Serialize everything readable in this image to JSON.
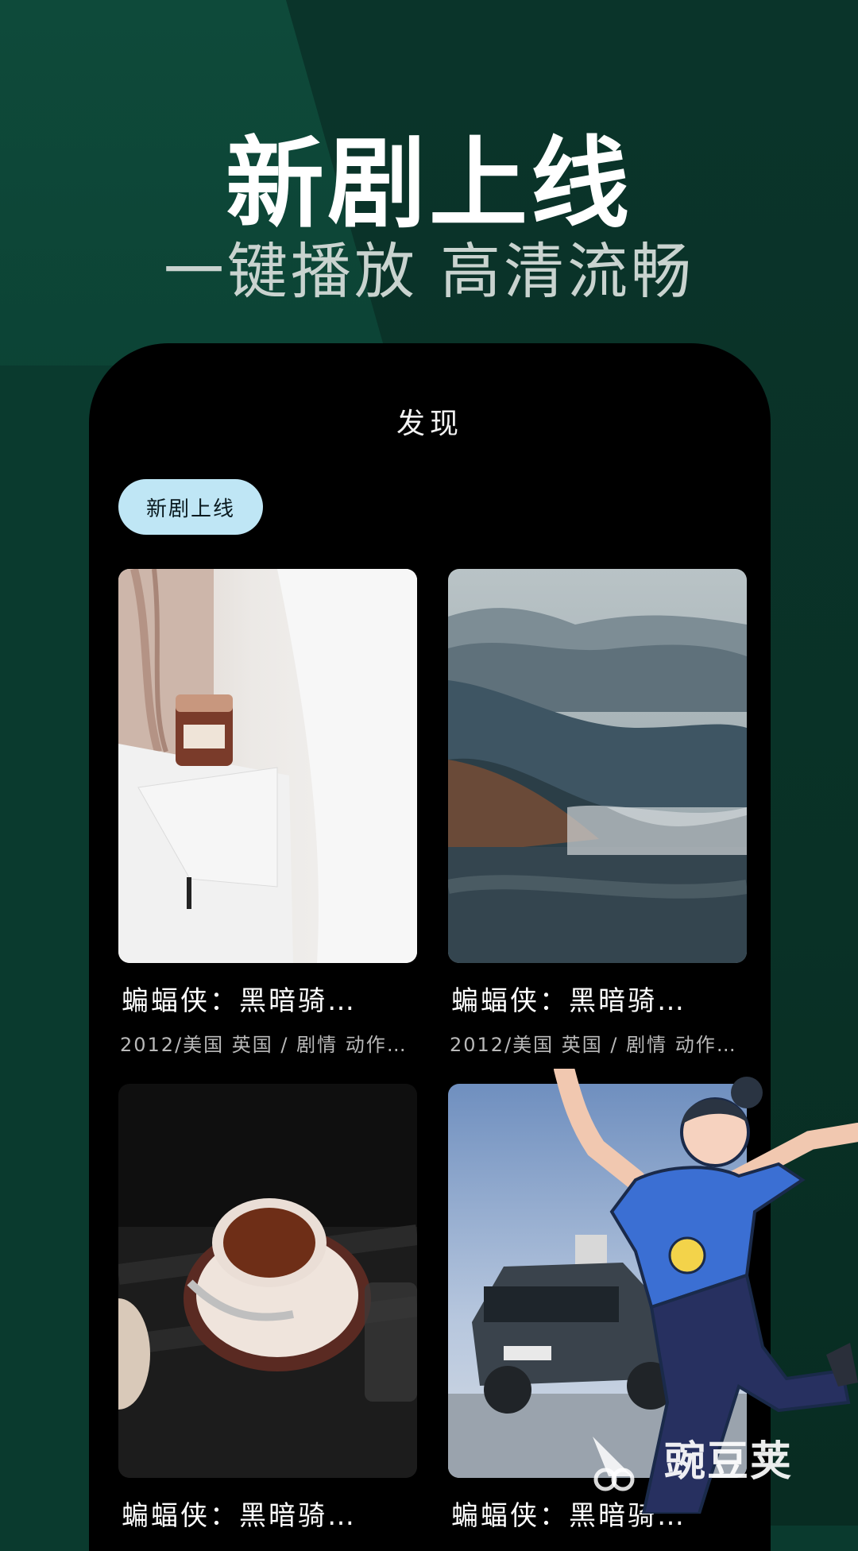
{
  "promo": {
    "headline": "新剧上线",
    "subline": "一键播放 高清流畅"
  },
  "screen": {
    "title": "发现",
    "chip_label": "新剧上线",
    "cards": [
      {
        "title": "蝙蝠侠：黑暗骑…",
        "meta": "2012/美国 英国 / 剧情 动作…"
      },
      {
        "title": "蝙蝠侠：黑暗骑…",
        "meta": "2012/美国 英国 / 剧情 动作…"
      },
      {
        "title": "蝙蝠侠：黑暗骑…",
        "meta": ""
      },
      {
        "title": "蝙蝠侠：黑暗骑…",
        "meta": ""
      }
    ]
  },
  "watermark": {
    "text": "豌豆荚"
  },
  "colors": {
    "background": "#0a3a2e",
    "phone": "#000000",
    "chip": "#bfe6f5"
  }
}
